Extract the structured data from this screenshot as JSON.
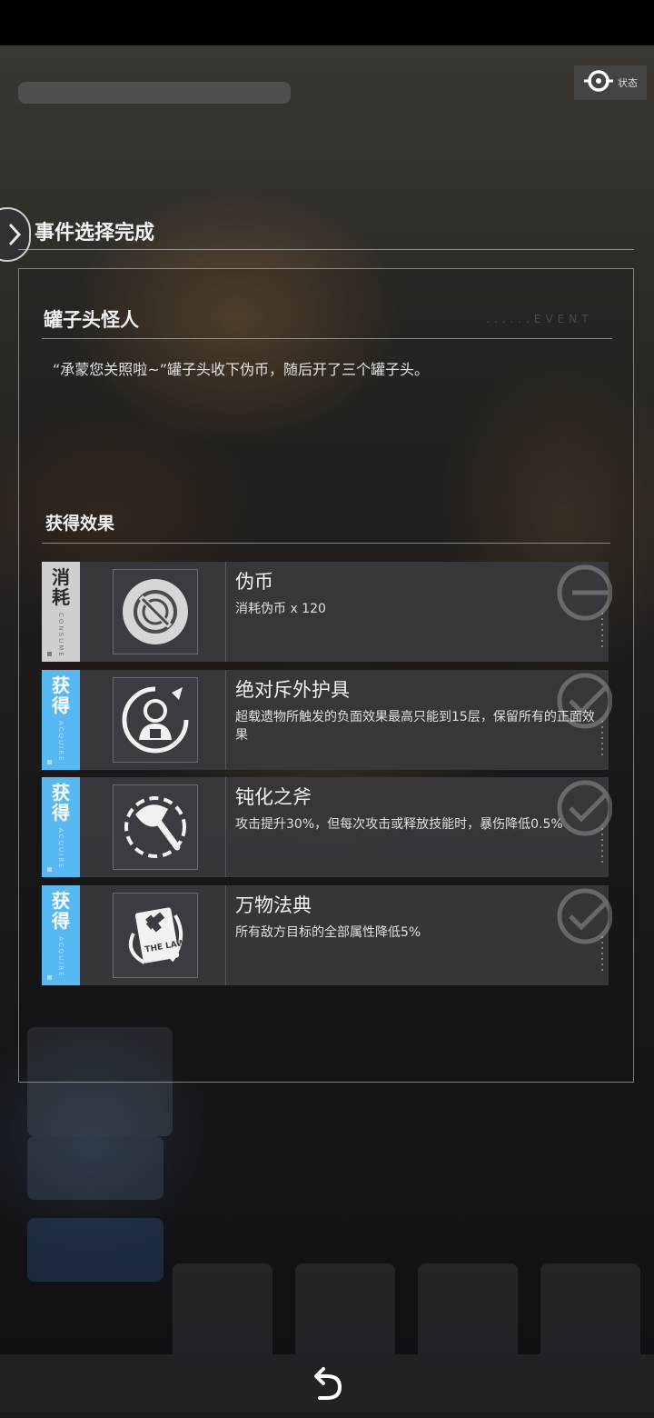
{
  "status_button": {
    "label": "状态",
    "icon": "status-icon"
  },
  "header": {
    "title": "事件选择完成",
    "icon": "chevron-right-icon"
  },
  "event": {
    "name": "罐子头怪人",
    "watermark": "......EVENT",
    "description": "“承蒙您关照啦~”罐子头收下伪币，随后开了三个罐子头。"
  },
  "effects": {
    "title": "获得效果",
    "items": [
      {
        "tag": "消耗",
        "tag_sub": "CONSUME",
        "type": "consume",
        "name": "伪币",
        "effect": "消耗伪币 x 120",
        "icon": "coin-icon"
      },
      {
        "tag": "获得",
        "tag_sub": "ACQUIRE",
        "type": "gain",
        "name": "绝对斥外护具",
        "effect": "超载遗物所触发的负面效果最高只能到15层，保留所有的正面效果",
        "icon": "armor-icon"
      },
      {
        "tag": "获得",
        "tag_sub": "ACQUIRE",
        "type": "gain",
        "name": "钝化之斧",
        "effect": "攻击提升30%，但每次攻击或释放技能时，暴伤降低0.5%",
        "icon": "axe-icon"
      },
      {
        "tag": "获得",
        "tag_sub": "ACQUIRE",
        "type": "gain",
        "name": "万物法典",
        "effect": "所有敌方目标的全部属性降低5%",
        "icon": "law-book-icon",
        "icon_text": "THE LAW"
      }
    ]
  },
  "navigation": {
    "back_icon": "back-arrow-icon"
  },
  "colors": {
    "consume_tag": "#cfcfcf",
    "gain_tag": "#58b8f2",
    "row_bg": "#3a3a40"
  }
}
